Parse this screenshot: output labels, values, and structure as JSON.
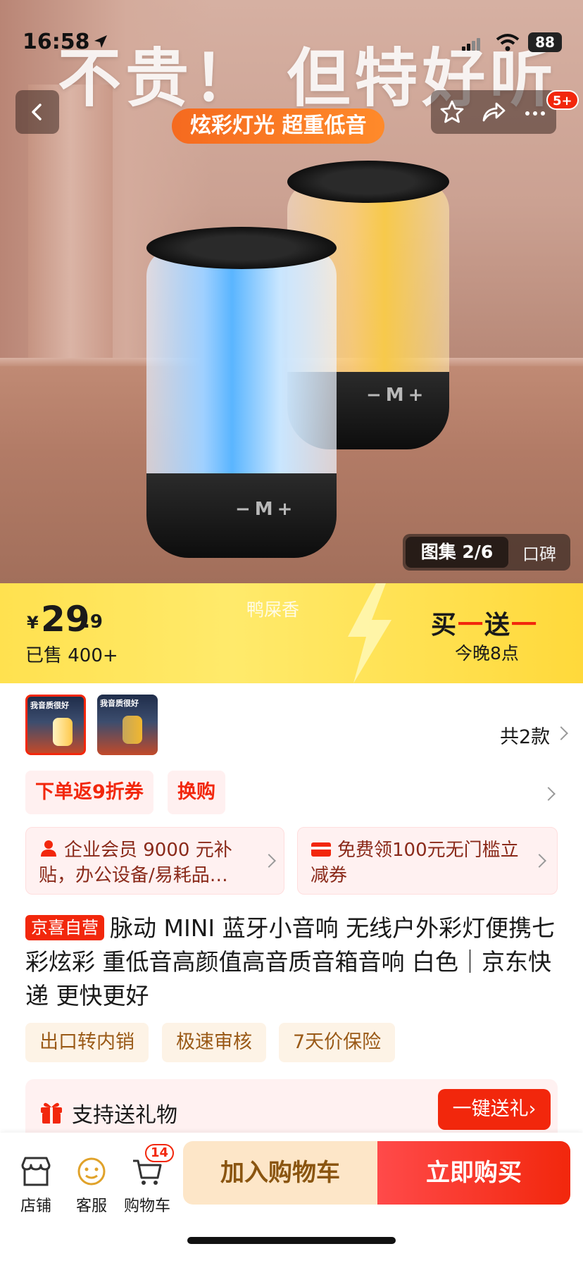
{
  "status_bar": {
    "time": "16:58",
    "battery": "88"
  },
  "hero": {
    "headline": "不贵！ 但特好听",
    "tagline": "炫彩灯光 超重低音",
    "notification_badge": "5+",
    "gallery": {
      "current": "图集 2/6",
      "reviews": "口碑"
    }
  },
  "price": {
    "currency": "¥",
    "integer": "29",
    "decimal": ".9",
    "sold": "已售 400+",
    "variant_note": "鸭屎香",
    "promo_title_a": "买",
    "promo_title_b": "送",
    "dash": "一",
    "promo_time": "今晚8点"
  },
  "variants": {
    "thumb_text": "我音质很好",
    "count": "共2款"
  },
  "coupons": [
    "下单返9折券",
    "换购"
  ],
  "benefits": [
    {
      "text": "企业会员 9000 元补贴，办公设备/易耗品…"
    },
    {
      "text": "免费领100元无门槛立减券"
    }
  ],
  "product": {
    "tag": "京喜自营",
    "title": "脉动 MINI 蓝牙小音响 无线户外彩灯便携七彩炫彩 重低音高颜值高音质音箱音响 白色｜京东快递 更快更好"
  },
  "services": [
    "出口转内销",
    "极速审核",
    "7天价保险"
  ],
  "gift": {
    "label": "支持送礼物",
    "button": "一键送礼›"
  },
  "bottom_bar": {
    "store": "店铺",
    "service": "客服",
    "cart": "购物车",
    "cart_count": "14",
    "add_to_cart": "加入购物车",
    "buy_now": "立即购买"
  },
  "colors": {
    "accent": "#f2270c",
    "banner_yellow": "#ffe14f",
    "cart_button": "#fde6c8"
  }
}
